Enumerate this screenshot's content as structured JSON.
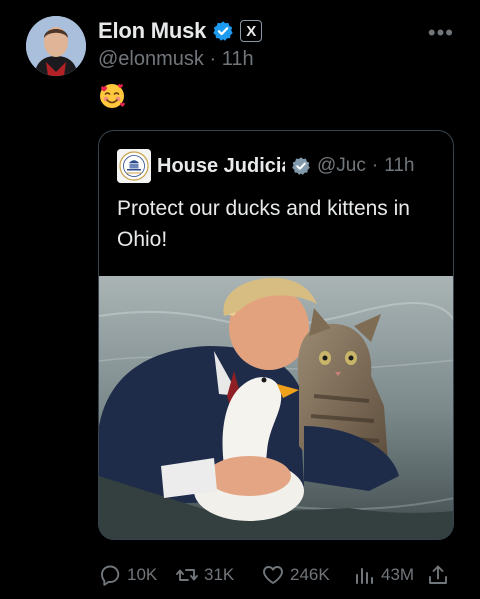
{
  "author": {
    "name": "Elon Musk",
    "handle": "@elonmusk",
    "separator": "·",
    "time": "11h",
    "verified_color": "#1d9bf0",
    "affiliate_badge_label": "X"
  },
  "post": {
    "emoji": "smiling-face-with-hearts"
  },
  "quoted_post": {
    "author_name": "House Judicia",
    "handle": "@Juc",
    "separator": "·",
    "time": "11h",
    "verified_color": "#829aab",
    "text": "Protect our ducks and kittens in Ohio!",
    "image_description_icon": "photo"
  },
  "actions": {
    "replies": "10K",
    "reposts": "31K",
    "likes": "246K",
    "views": "43M"
  }
}
